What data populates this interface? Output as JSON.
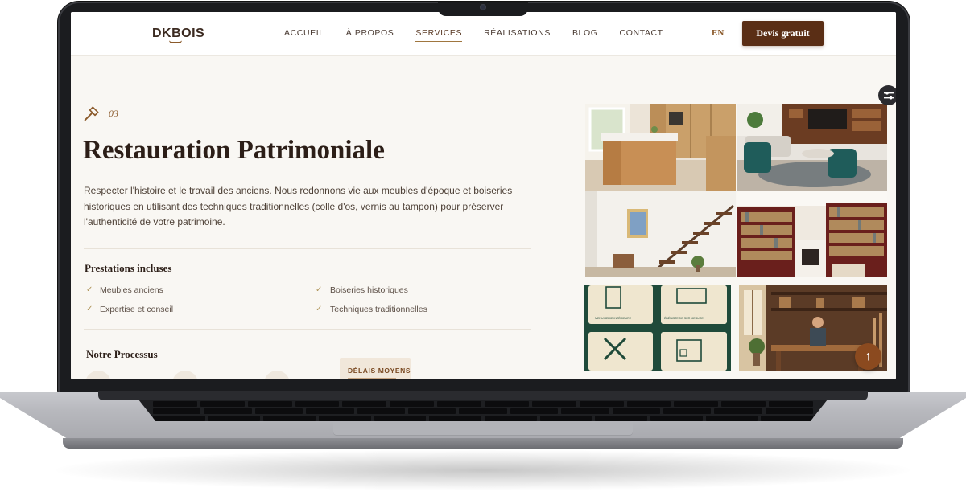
{
  "header": {
    "logo_text": "DKBOIS",
    "nav": [
      {
        "label": "ACCUEIL"
      },
      {
        "label": "À PROPOS"
      },
      {
        "label": "SERVICES",
        "active": true
      },
      {
        "label": "RÉALISATIONS"
      },
      {
        "label": "BLOG"
      },
      {
        "label": "CONTACT"
      }
    ],
    "lang": "EN",
    "cta": "Devis gratuit"
  },
  "service": {
    "number": "03",
    "icon": "hammer-icon",
    "title": "Restauration Patrimoniale",
    "description": "Respecter l'histoire et le travail des anciens. Nous redonnons vie aux meubles d'époque et boiseries historiques en utilisant des techniques traditionnelles (colle d'os, vernis au tampon) pour préserver l'authenticité de votre patrimoine."
  },
  "prestations": {
    "title": "Prestations incluses",
    "items": [
      "Meubles anciens",
      "Boiseries historiques",
      "Expertise et conseil",
      "Techniques traditionnelles"
    ]
  },
  "process": {
    "title": "Notre Processus",
    "delay_label": "DÉLAIS MOYENS"
  },
  "gallery": {
    "tiles": [
      "kitchen-photo",
      "living-room-photo",
      "staircase-photo",
      "library-photo",
      "floor-plan-illustration",
      "workshop-photo"
    ],
    "illustration_labels": [
      "MENUISERIE INTÉRIEURE",
      "ÉBÉNISTERIE SUR MESURE"
    ]
  },
  "colors": {
    "brand": "#5a2e15",
    "accent": "#8b5a2b",
    "background": "#f9f7f3",
    "dark_text": "#2c1e17"
  },
  "icons": {
    "toggle": "settings-toggle-icon",
    "scroll": "arrow-up-icon",
    "check": "check-icon"
  }
}
